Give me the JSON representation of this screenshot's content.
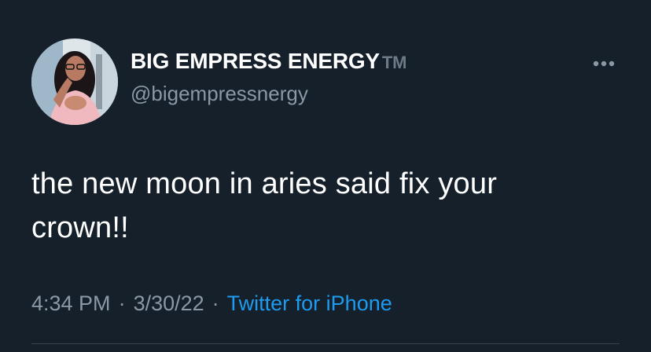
{
  "author": {
    "display_name": "BIG EMPRESS ENERGY",
    "display_suffix": "TM",
    "handle": "@bigempressnergy"
  },
  "tweet": {
    "text": "the new moon in aries said fix your crown!!",
    "time": "4:34 PM",
    "date": "3/30/22",
    "separator": "·",
    "source": "Twitter for iPhone"
  },
  "icons": {
    "more": "more-horizontal-icon"
  },
  "colors": {
    "background": "#15202b",
    "text_primary": "#ffffff",
    "text_secondary": "#8b98a5",
    "accent": "#1d9bf0",
    "divider": "#38444d"
  }
}
